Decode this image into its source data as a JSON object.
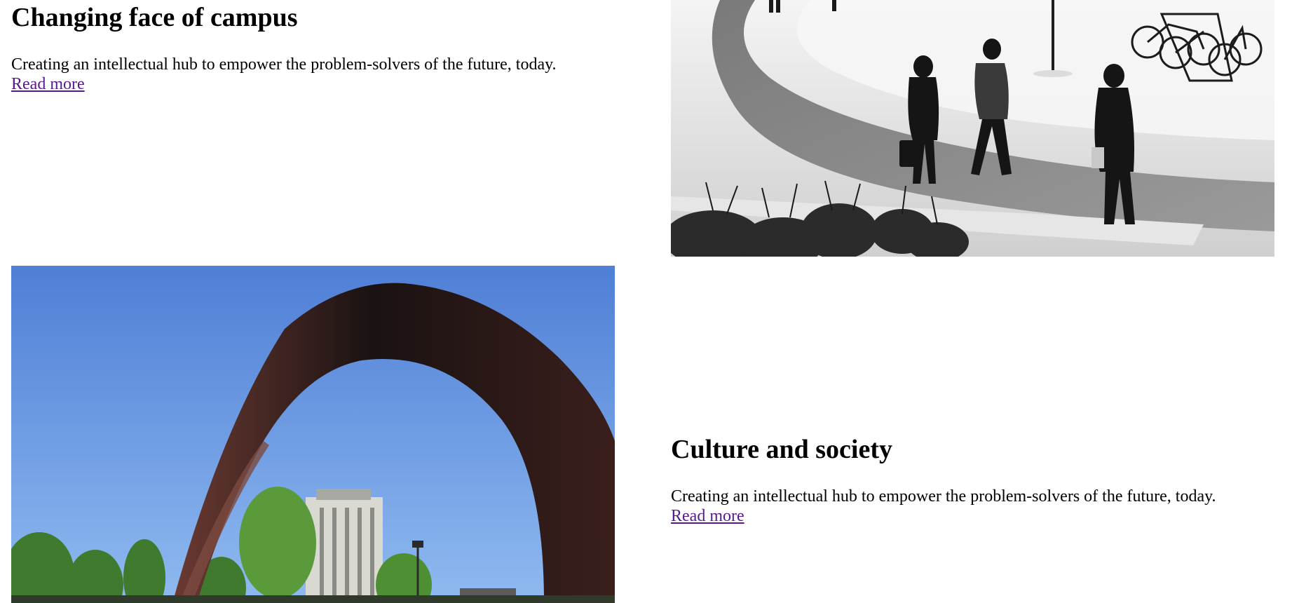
{
  "sections": [
    {
      "title": "Changing face of campus",
      "description": "Creating an intellectual hub to empower the problem-solvers of the future, today.",
      "link_label": "Read more"
    },
    {
      "title": "Culture and society",
      "description": "Creating an intellectual hub to empower the problem-solvers of the future, today.",
      "link_label": "Read more"
    }
  ],
  "colors": {
    "link_visited": "#551a8b",
    "text": "#000000",
    "background": "#ffffff"
  }
}
